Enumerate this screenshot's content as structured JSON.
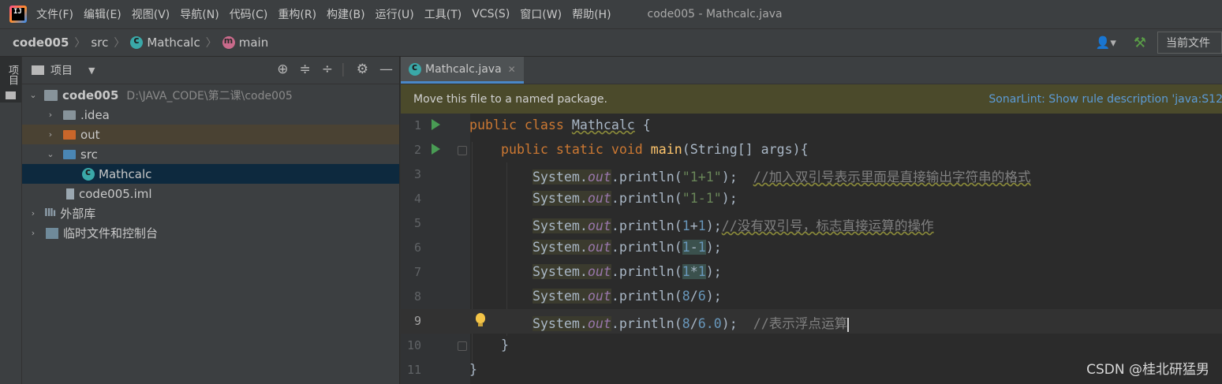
{
  "menubar": {
    "logo_text": "IJ",
    "items": [
      "文件(F)",
      "编辑(E)",
      "视图(V)",
      "导航(N)",
      "代码(C)",
      "重构(R)",
      "构建(B)",
      "运行(U)",
      "工具(T)",
      "VCS(S)",
      "窗口(W)",
      "帮助(H)"
    ],
    "window_title": "code005 - Mathcalc.java"
  },
  "navbar": {
    "crumbs": [
      "code005",
      "src",
      "Mathcalc",
      "main"
    ],
    "run_config": "当前文件"
  },
  "sidebar": {
    "tab_label": "项目"
  },
  "project": {
    "title": "项目",
    "root": {
      "name": "code005",
      "path": "D:\\JAVA_CODE\\第二课\\code005"
    },
    "items": [
      ".idea",
      "out",
      "src",
      "Mathcalc",
      "code005.iml",
      "外部库",
      "临时文件和控制台"
    ]
  },
  "editor": {
    "tab_label": "Mathcalc.java",
    "banner_message": "Move this file to a named package.",
    "banner_link": "SonarLint: Show rule description 'java:S12",
    "line_numbers": [
      "1",
      "2",
      "3",
      "4",
      "5",
      "6",
      "7",
      "8",
      "9",
      "10",
      "11"
    ],
    "comments": [
      "//加入双引号表示里面是直接输出字符串的格式",
      "//没有双引号，标志直接运算的操作",
      "//表示浮点运算"
    ]
  },
  "watermark": "CSDN @桂北研猛男",
  "colors": {
    "accent": "#4a88c7",
    "run": "#499c54",
    "banner": "#4b4a2b",
    "keyword": "#cc7832"
  }
}
